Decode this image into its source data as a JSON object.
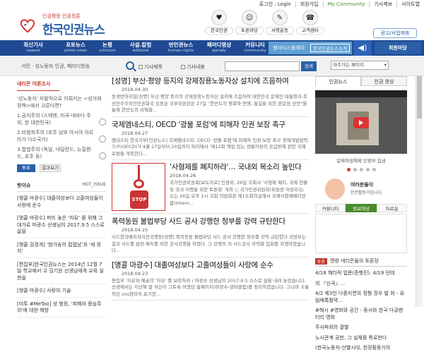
{
  "topbar": {
    "login": "로그인 : Login",
    "join": "회원가입",
    "my_community": "My Community",
    "subscribe": "기사제보",
    "sitemap": "사이트맵"
  },
  "header": {
    "tagline": "인권평등 인권정론",
    "logo": "한국인권뉴스",
    "icons": [
      {
        "label": "한국인권",
        "glyph": "♥"
      },
      {
        "label": "토론마당",
        "glyph": "☺"
      },
      {
        "label": "서명운동",
        "glyph": "✎"
      },
      {
        "label": "고객센터",
        "glyph": "☎"
      }
    ],
    "ad_link": "광고/사업제휴"
  },
  "nav": {
    "items": [
      {
        "k": "최신기사",
        "e": "newest"
      },
      {
        "k": "포토뉴스",
        "e": "photo news"
      },
      {
        "k": "논평",
        "e": "criticism"
      },
      {
        "k": "사설.칼럼",
        "e": "editorial"
      },
      {
        "k": "반인권뉴스",
        "e": "human rights"
      },
      {
        "k": "패러디영상",
        "e": "parody"
      },
      {
        "k": "커뮤니티",
        "e": "community"
      }
    ],
    "display": "행사디스플레이",
    "shortcut": "한국인권뉴스소개",
    "member": "회원마당"
  },
  "search": {
    "breadcrumb": "서민 · 성노동자 인권, 패러디방송",
    "opt1": "기사제목",
    "opt2": "기사내용",
    "button": "검색",
    "keyword_placeholder": "자주가는 페이지"
  },
  "poll": {
    "title": "네티즌 여론조사",
    "question": "'성노동자' 자발적으로 이뤄지는 <성거래 정책>에서 고른다면?",
    "options": [
      "1.금지주의 (스웨덴, 미국-네바다 주 외, 한 대한민국)",
      "2.비범죄주의 (호주 남부 아시아 아르라가 다수국가)",
      "3.합법주의 (독일, 네덜란드, 뉴질랜드, 호주 등)"
    ],
    "vote": "투표",
    "result": "결과보기"
  },
  "hot": {
    "title": "핫이슈",
    "label": "HOT_ISSUE",
    "items": [
      "[앵콜 마광수] 대졸여성보다 고졸여성들이 사랑에 순수",
      "[앵콜 마광수] 퍼뜨 놓은 '자유' 를 위해 그 대가로 마광수 선생님이 2017.9.5 스스로 삶을",
      "[앵콜 검경개] '범가송이 접접남'과 '세 정치'",
      "[편집부]한국인권뉴스는 2014년 12월 7일 학교에서 고 김기원 선생님에게 교육 실현을",
      "[앵콜 마광수] 사랑의 기술",
      "[미투 #MeToo] 성 범정, '피해자 중심주의'에 대한 해방"
    ]
  },
  "articles": [
    {
      "title": "[성명] 부산·평양 등지의 강제징용노동자상 설치에 즈음하여",
      "date": "2018.04.30",
      "body": "동생반마모임[성명] 부산·평양 등지의 강제징용노동자상 설치에 즈음하여 대한민국 문재인 대통령과 조선민주주의인민공화국 김정은 국무위원장은 27일 \"한반도의 평화와 번영, 통일을 위한 판문점 선언\"을 통해 한반도의 비핵화..."
    },
    {
      "title": "국제엠네스티, OECD '광물 포럼'에 피해자 인권 보장 촉구",
      "date": "2018.04.27",
      "body": "엠네스티 한국지부[인권뉴스] 국제엠네스티, OECD '광물 포럼'에 피해자 인권 보장 촉구 경제개발협력기구(OECD)가 4월 17일부터 20일까지 파리에서 '제12회 책임 있는 광물자원의 공급망에 관한 국제 포럼을 개최한다..."
    },
    {
      "title": "'사형제를 폐지하라'… 국내외 목소리 높인다",
      "date": "2018.04.26",
      "body": "국가인권위원회[보도자료] 인권위, 26일 국회서 '사형제 폐지, 국제 현황 및 국내 이행을 위한 토론회' 개최 ○ 국가인권위원회(위원장 이성호)는 오는 26일 오후 2시 국회 의원회관 제1소회의실에서 국제사형제폐지연합(Intern..."
    },
    {
      "title": "폭력동원 불법부당 사드 공사 강행한 정부를 강력 규탄한다",
      "date": "2018.04.25",
      "body": "사드한국배치저지전국행동[성명] 폭력동원 불법부당 사드 공사 강행한 정부를 강력 규탄한다 국방부는 결국 사드를 완전 배치를 위한 공사강행을 하였다. 그 강행의 이 사드공사 무력화 집회를 자행하였습니다..."
    },
    {
      "title": "[앵콜 마광수] 대졸여성보다 고졸여성들이 사랑에 순수",
      "date": "2018.04.23",
      "body": "편집부 '자유와 예술의 '자유' 를 보장하라 / 마광수 선생님이 2017.9.5 스스로 삶을 내려 놓았습니다. 선생께서는 지난해 말 자신이 그토록 아꼈던 홈페이지(마광수-광마클럽)를 정리하였습니다. 그나마 소통하던 sns창마저 포기한..."
    }
  ],
  "feature_stop": "STOP",
  "right": {
    "tabs": [
      "인권뉴스",
      "인권 영상"
    ],
    "video_caption": "일제하원해제 단왕부 입금",
    "ad_title": "여러분들이",
    "ad_sub": "인권활동가입니다",
    "tabs3": [
      "커뮤니티",
      "정보마당",
      "자료실"
    ],
    "debate_badge": "토론",
    "debate_title": "명랑 네티즌들의 토론장",
    "debate_items": [
      "4/18 해라적 업문(준행진). 4/19 단테",
      "의 『신곡』...",
      "4/2 제3인 다중지연의 정형 장우 발 화 - 유림매록활약...",
      "#해시 #영화와 공간 - 동서와 한국 다큐멘터리 영화",
      "주사파와의 결별",
      "노사관계 공헌, 그 실체를 폭로한다",
      "(한국노동자-산별시대, 현장활동가의"
    ]
  }
}
